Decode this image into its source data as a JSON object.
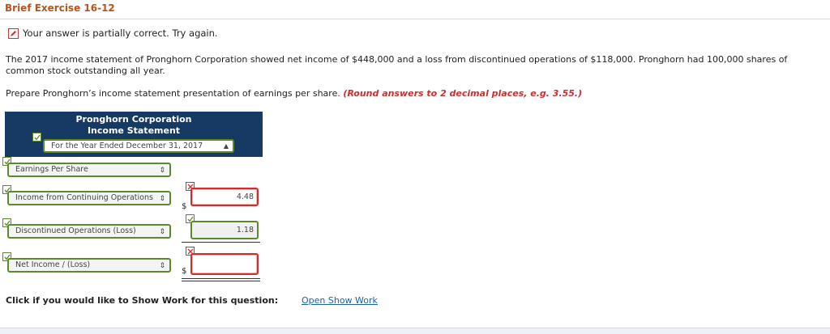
{
  "header": {
    "title": "Brief Exercise 16-12"
  },
  "status": {
    "text": "Your answer is partially correct.  Try again."
  },
  "question": {
    "paragraph1": "The 2017 income statement of Pronghorn Corporation showed net income of $448,000 and a loss from discontinued operations of $118,000. Pronghorn had 100,000 shares of common stock outstanding all year.",
    "paragraph2": "Prepare Pronghorn’s income statement presentation of earnings per share.",
    "hint": "(Round answers to 2 decimal places, e.g. 3.55.)"
  },
  "statement": {
    "company": "Pronghorn Corporation",
    "name": "Income Statement",
    "period": "For the Year Ended December 31, 2017",
    "rows": [
      {
        "label": "Earnings Per Share",
        "amount": null,
        "dollar": ""
      },
      {
        "label": "Income from Continuing Operations",
        "amount": "4.48",
        "dollar": "$"
      },
      {
        "label": "Discontinued Operations (Loss)",
        "amount": "1.18",
        "dollar": ""
      },
      {
        "label": "Net Income / (Loss)",
        "amount": "",
        "dollar": "$"
      }
    ]
  },
  "show_work": {
    "label": "Click if you would like to Show Work for this question:",
    "link": "Open Show Work"
  },
  "colors": {
    "title": "#b8531c",
    "header_bg": "#163a63",
    "correct": "#5a8a2a",
    "incorrect": "#d62a2a",
    "link": "#1a5fb4"
  }
}
